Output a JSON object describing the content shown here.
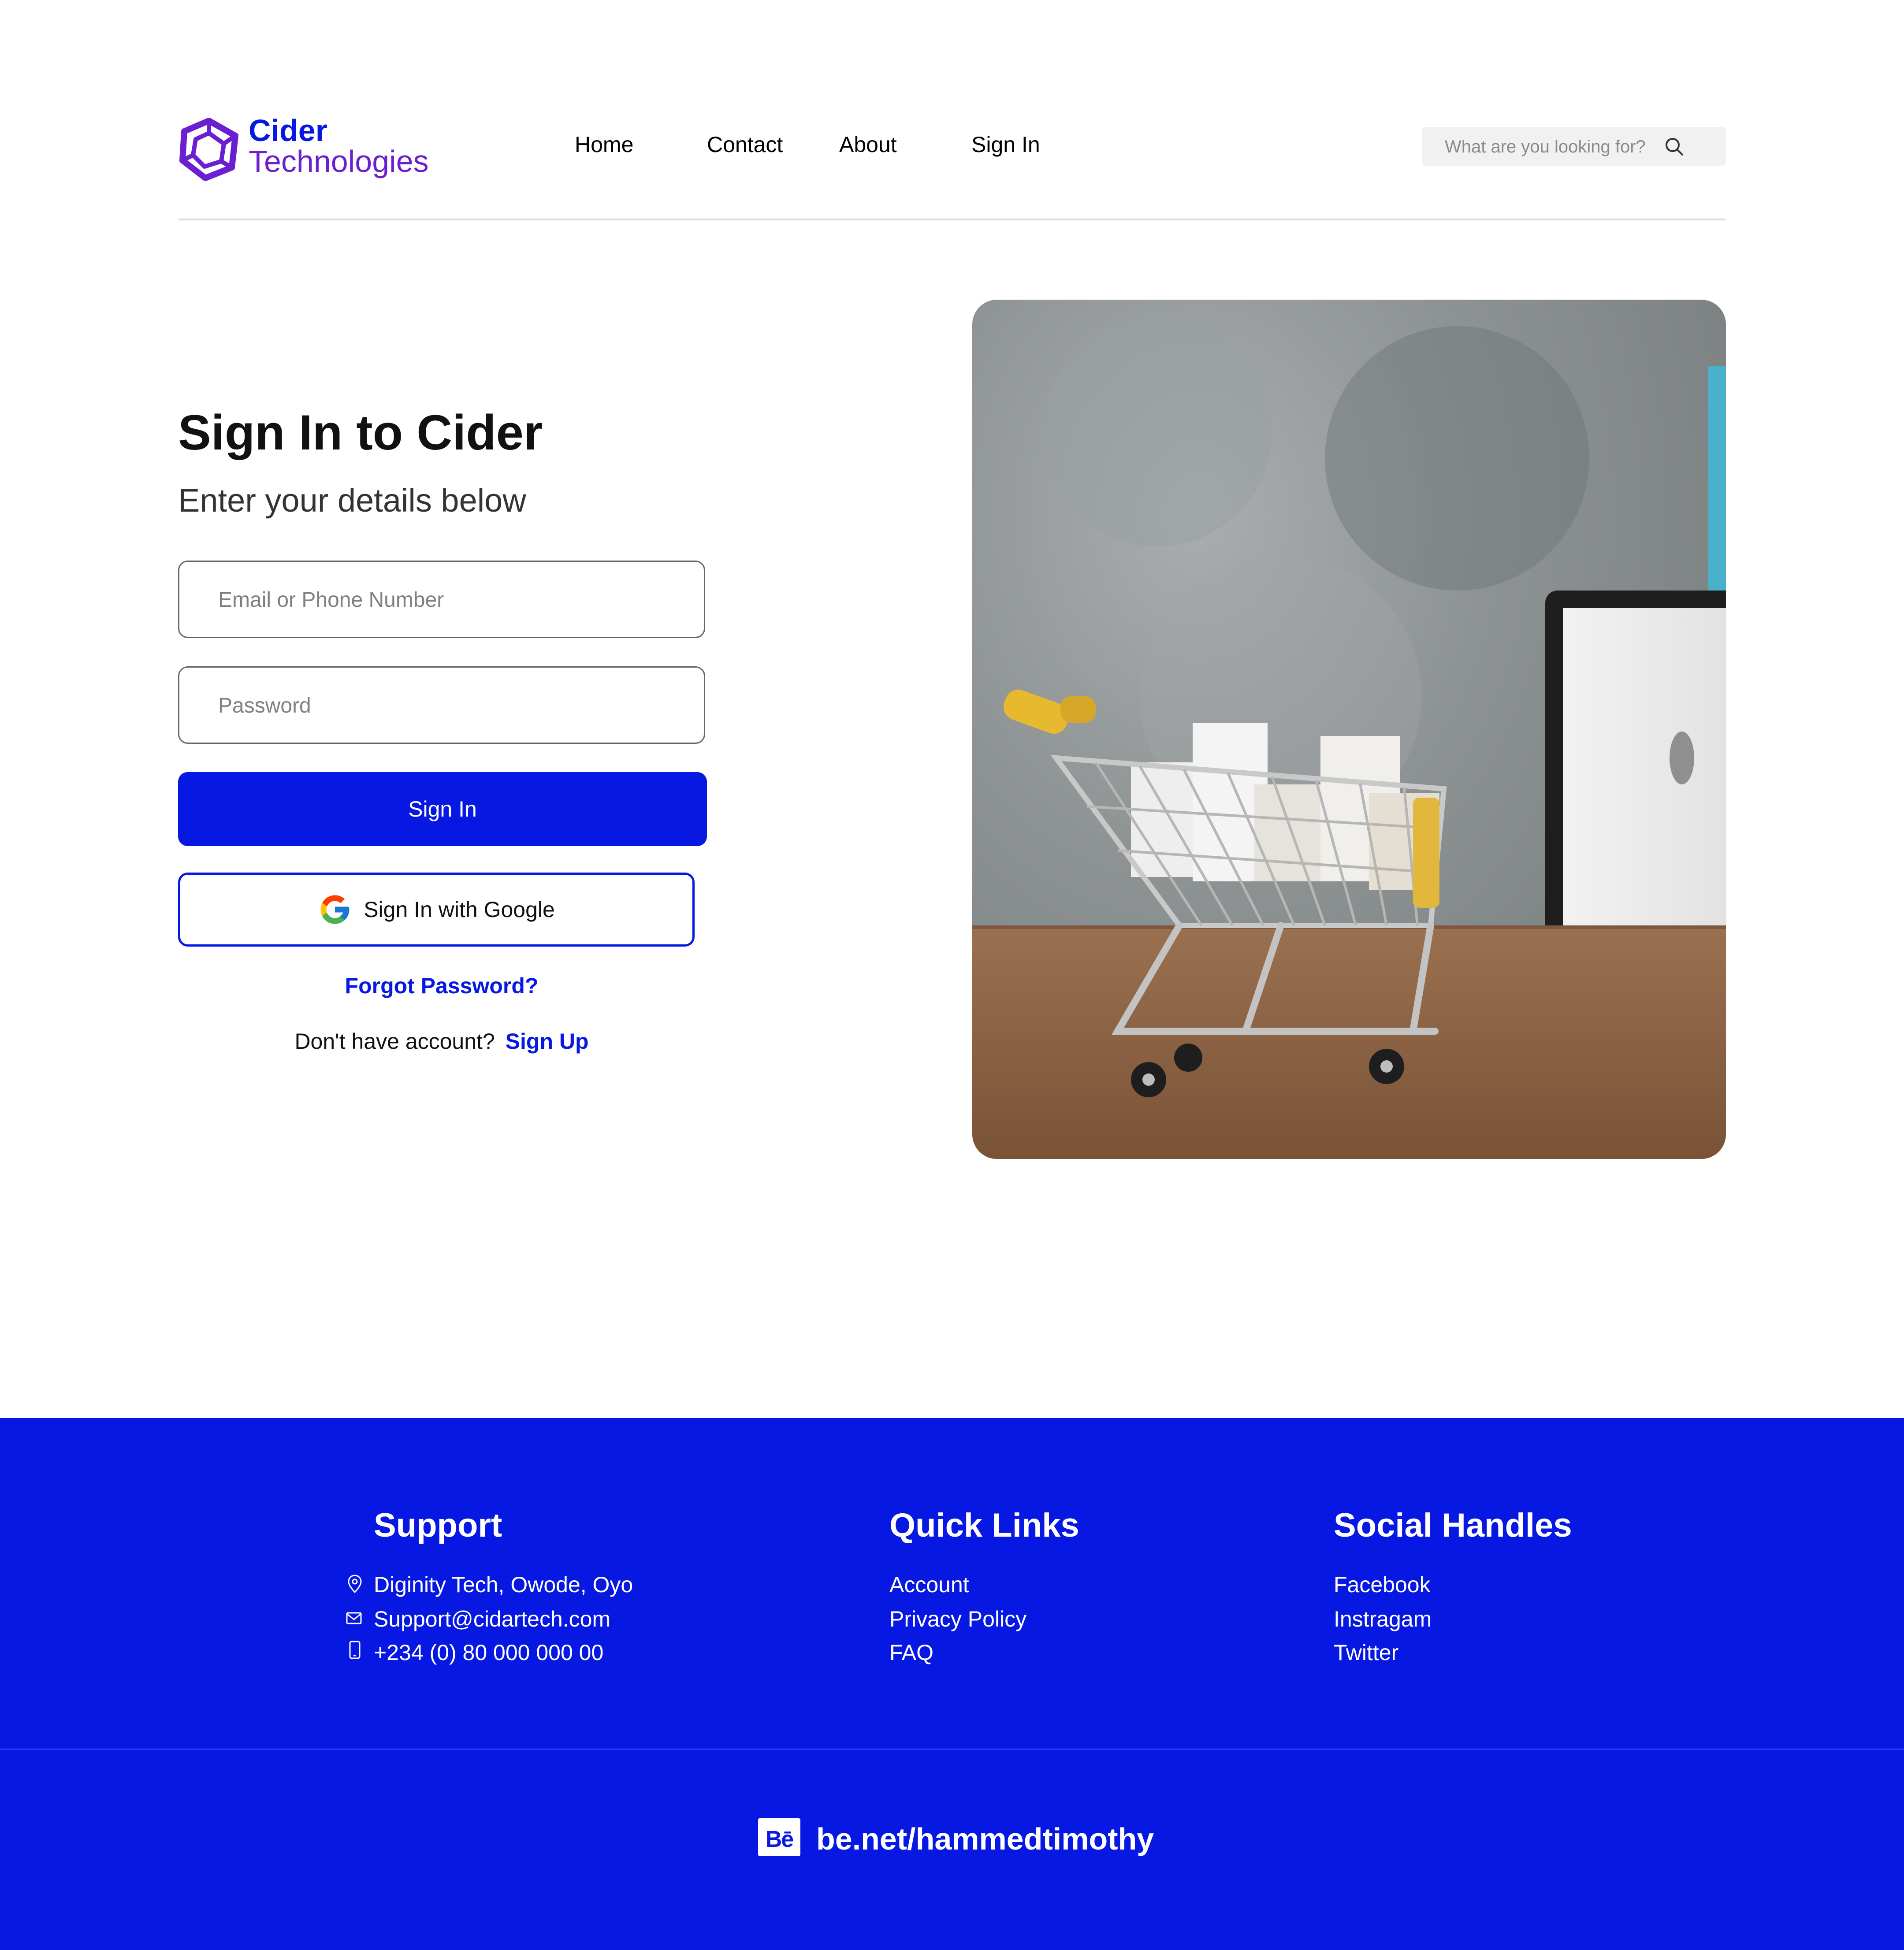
{
  "brand": {
    "name_line1": "Cider",
    "name_line2": "Technologies",
    "primary_color": "#0718e2",
    "accent_color": "#6a1fd1"
  },
  "nav": {
    "home": "Home",
    "contact": "Contact",
    "about": "About",
    "sign_in": "Sign In"
  },
  "search": {
    "placeholder": "What are you looking for?",
    "icon": "search-icon"
  },
  "form": {
    "title": "Sign In to Cider",
    "subtitle": "Enter your details below",
    "email_placeholder": "Email or Phone Number",
    "password_placeholder": "Password",
    "sign_in_button": "Sign In",
    "google_button": "Sign In with Google",
    "forgot_password": "Forgot Password?",
    "no_account_text": "Don't have account?",
    "sign_up_link": "Sign Up"
  },
  "footer": {
    "support": {
      "heading": "Support",
      "address": "Diginity Tech, Owode, Oyo",
      "email": "Support@cidartech.com",
      "phone": "+234 (0) 80 000 000 00"
    },
    "quick_links": {
      "heading": "Quick Links",
      "items": [
        "Account",
        "Privacy Policy",
        "FAQ"
      ]
    },
    "social": {
      "heading": "Social Handles",
      "items": [
        "Facebook",
        "Instragam",
        "Twitter"
      ]
    },
    "behance_icon_text": "Bē",
    "behance_link": "be.net/hammedtimothy"
  }
}
